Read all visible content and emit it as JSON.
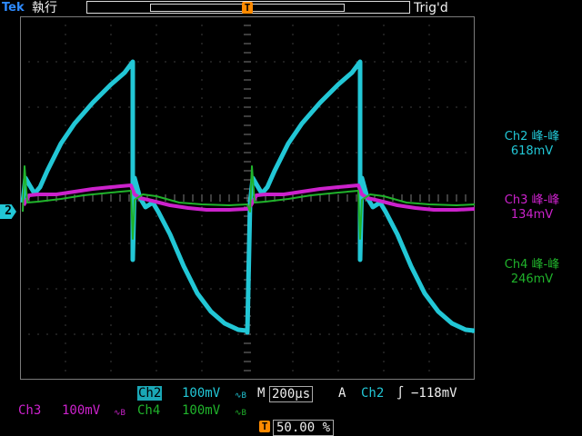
{
  "top": {
    "brand": "Tek",
    "mode": "執行",
    "trigger_status": "Trig'd",
    "trigger_marker": "T"
  },
  "markers": {
    "ch2_ground": "2"
  },
  "measurements": [
    {
      "channel": "Ch2",
      "label": "峰-峰",
      "value": "618mV",
      "color": "#22c7d6"
    },
    {
      "channel": "Ch3",
      "label": "峰-峰",
      "value": "134mV",
      "color": "#cc22cc"
    },
    {
      "channel": "Ch4",
      "label": "峰-峰",
      "value": "246mV",
      "color": "#20b32b"
    }
  ],
  "bottom": {
    "ch2": {
      "name": "Ch2",
      "scale": "100mV",
      "bw": "∿B"
    },
    "ch3": {
      "name": "Ch3",
      "scale": "100mV",
      "bw": "∿B"
    },
    "ch4": {
      "name": "Ch4",
      "scale": "100mV",
      "bw": "∿B"
    },
    "timebase_prefix": "M",
    "timebase": "200µs",
    "trigger_mode": "A",
    "trigger_source": "Ch2",
    "trigger_slope": "∫",
    "trigger_level": "−118mV",
    "trigger_pos_marker": "T",
    "trigger_position": "50.00 %"
  },
  "colors": {
    "ch2": "#22c7d6",
    "ch3": "#cc22cc",
    "ch4": "#20b32b",
    "grid": "#7a7a7a",
    "trigger": "#ff8a00"
  }
}
